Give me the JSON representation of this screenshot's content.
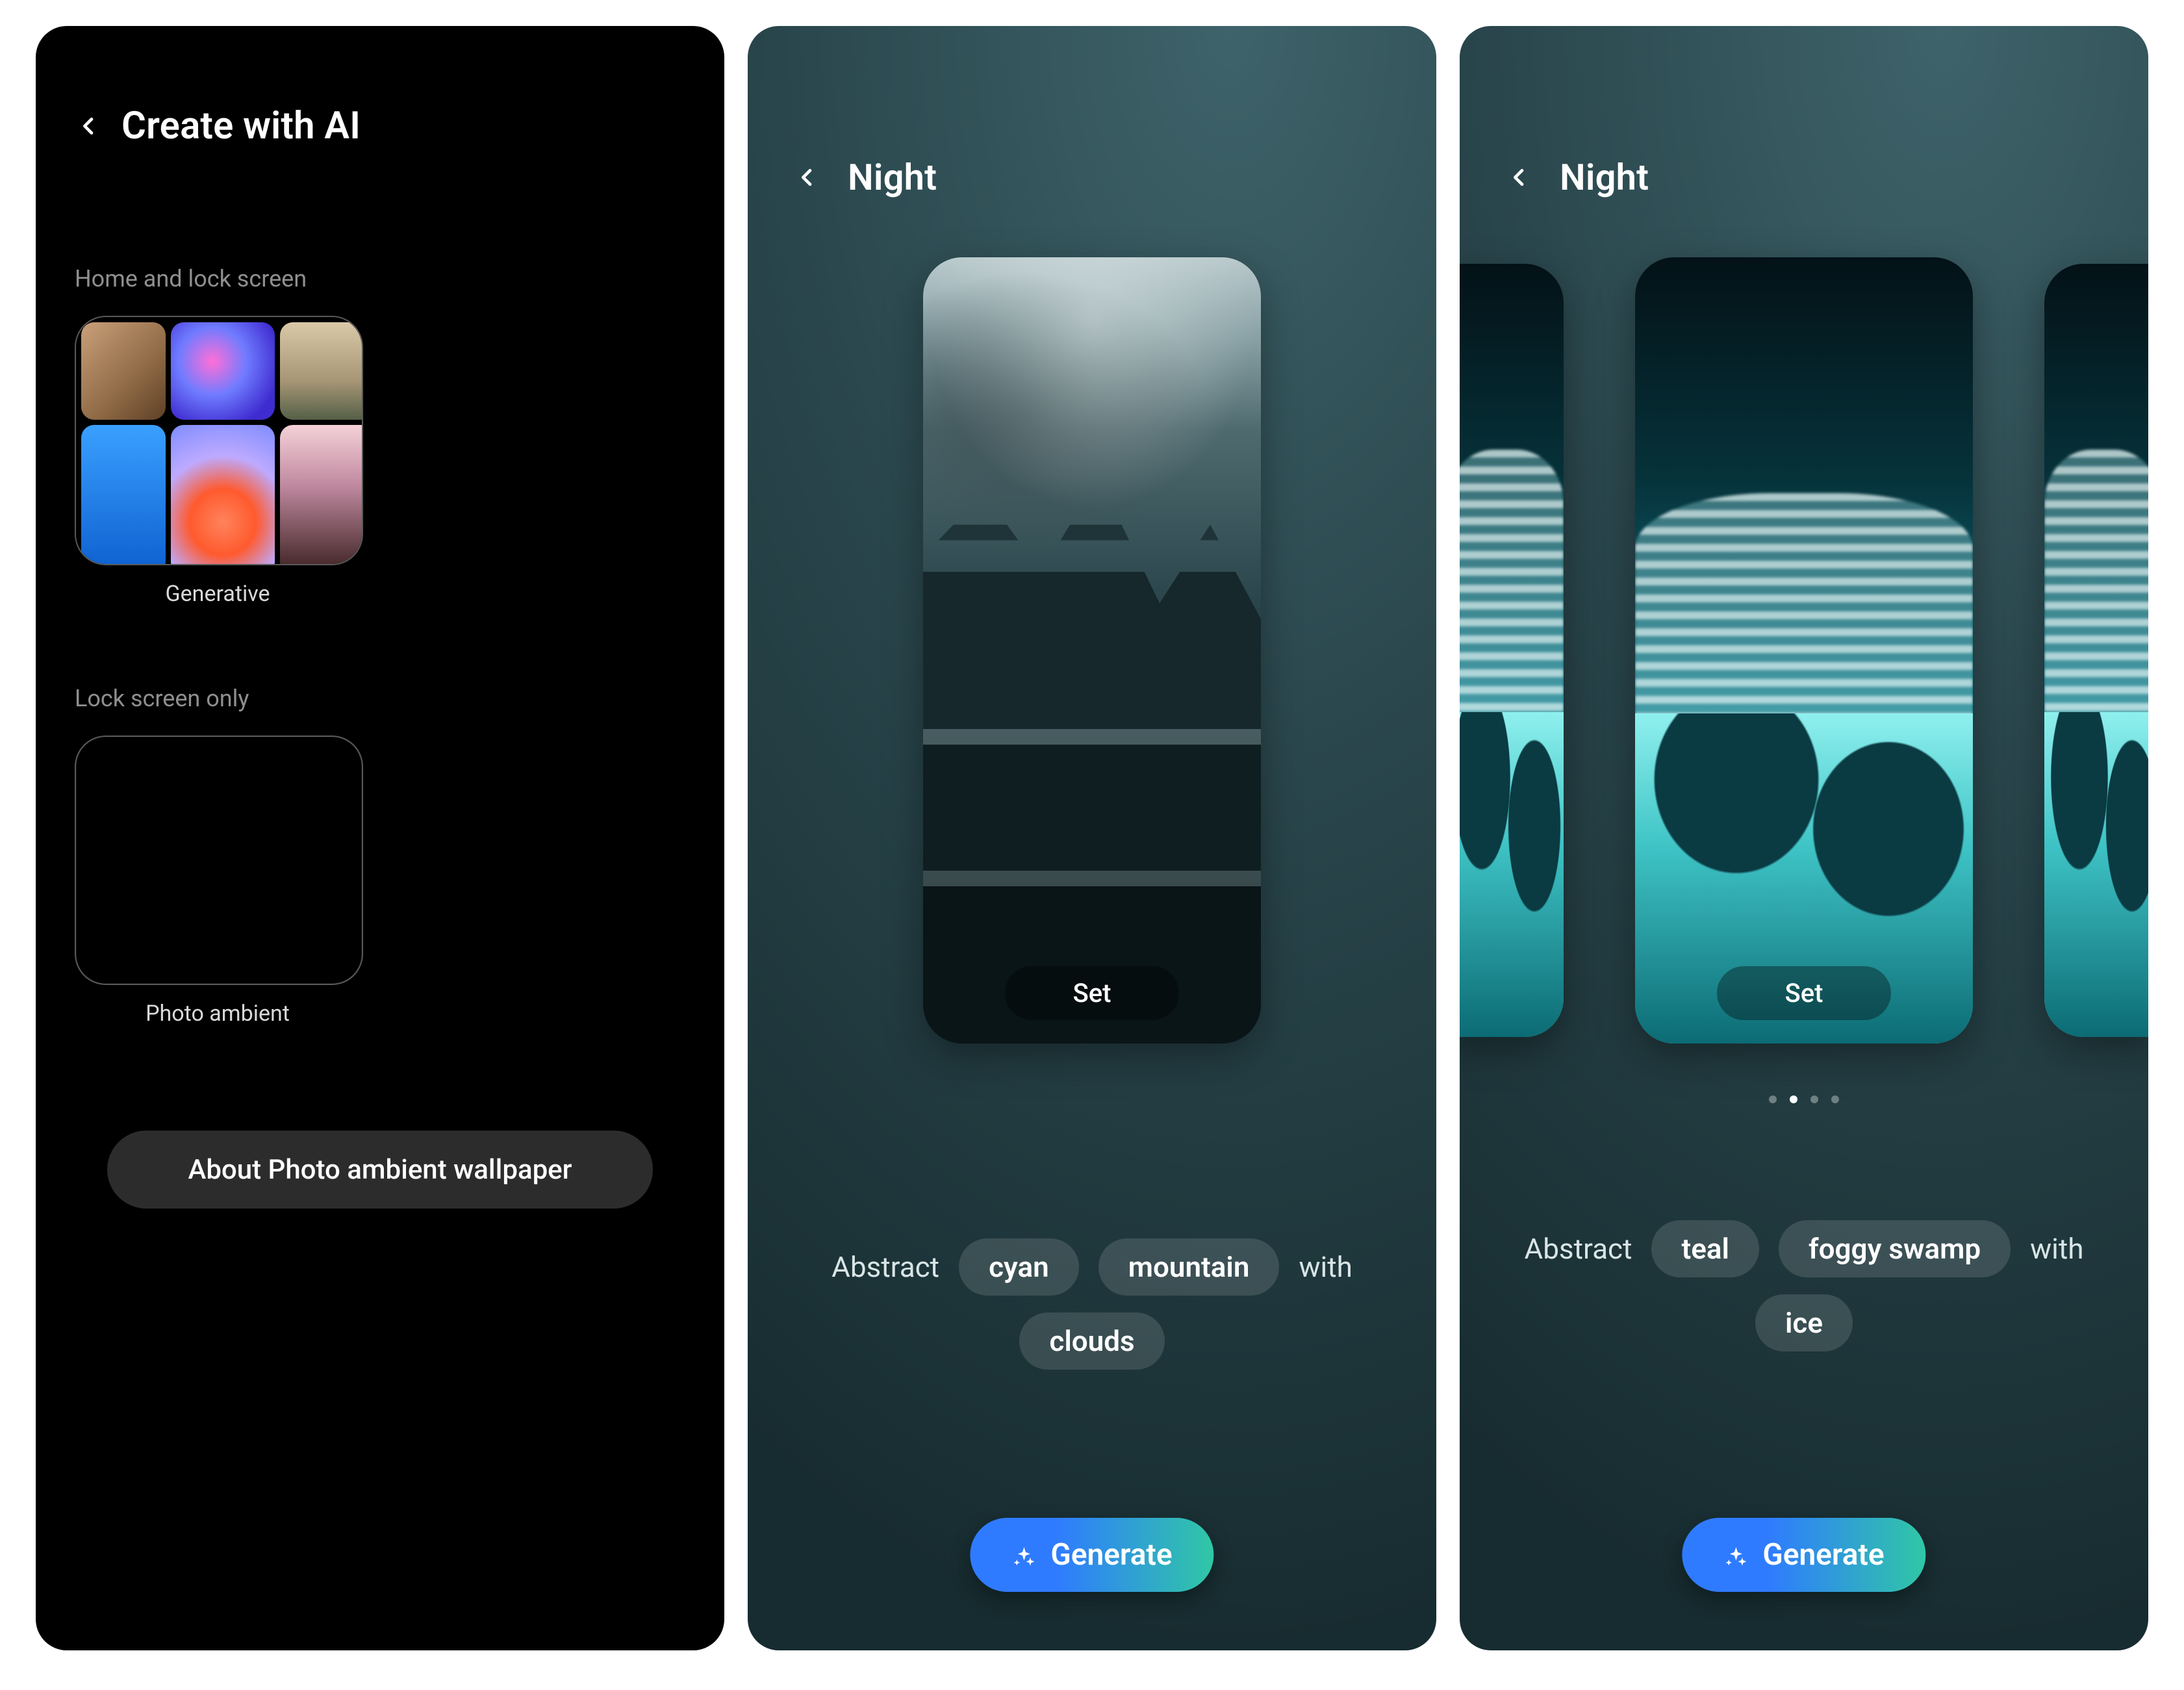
{
  "screen1": {
    "title": "Create with AI",
    "section_home_lock": "Home and lock screen",
    "tile_generative": "Generative",
    "section_lock_only": "Lock screen only",
    "tile_photo_ambient": "Photo ambient",
    "about_button": "About Photo ambient wallpaper"
  },
  "screen2": {
    "title": "Night",
    "set_button": "Set",
    "prompt": {
      "w1": "Abstract",
      "c1": "cyan",
      "c2": "mountain",
      "w2": "with",
      "c3": "clouds"
    },
    "generate_button": "Generate"
  },
  "screen3": {
    "title": "Night",
    "set_button": "Set",
    "pager": {
      "count": 4,
      "active_index": 1
    },
    "prompt": {
      "w1": "Abstract",
      "c1": "teal",
      "c2": "foggy swamp",
      "w2": "with",
      "c3": "ice"
    },
    "generate_button": "Generate"
  }
}
